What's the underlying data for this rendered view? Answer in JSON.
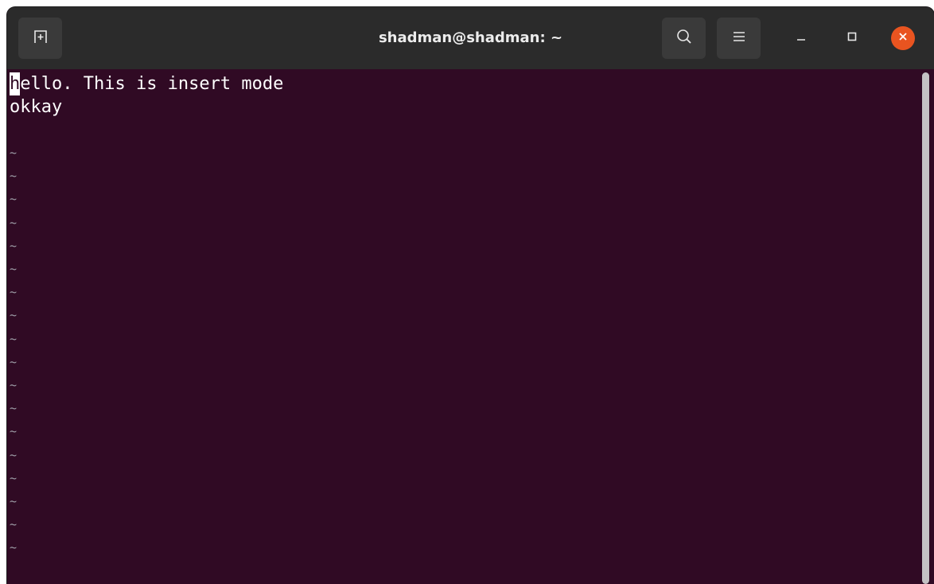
{
  "window": {
    "title": "shadman@shadman: ~"
  },
  "titlebar": {
    "buttons": {
      "new_tab_icon": "new-tab-icon",
      "search_icon": "search-icon",
      "menu_icon": "hamburger-menu-icon",
      "minimize_icon": "minimize-icon",
      "maximize_icon": "maximize-icon",
      "close_icon": "close-icon"
    }
  },
  "terminal": {
    "cursor_char": "h",
    "line1_rest": "ello. This is insert mode",
    "line2": "okkay",
    "tilde": "~",
    "empty_line_markers": 18
  },
  "colors": {
    "background": "#300a24",
    "titlebar": "#2b2b2b",
    "close_button": "#e95420",
    "text": "#ffffff",
    "tilde": "#9e9ea7"
  }
}
